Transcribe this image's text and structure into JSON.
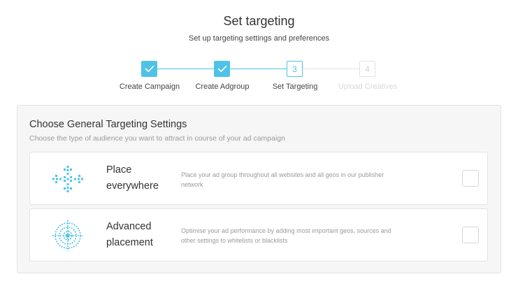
{
  "header": {
    "title": "Set targeting",
    "subtitle": "Set up targeting settings and preferences"
  },
  "stepper": {
    "steps": [
      {
        "number": "1",
        "label": "Create Campaign",
        "state": "completed"
      },
      {
        "number": "2",
        "label": "Create Adgroup",
        "state": "completed"
      },
      {
        "number": "3",
        "label": "Set Targeting",
        "state": "active"
      },
      {
        "number": "4",
        "label": "Upload Creatives",
        "state": "upcoming"
      }
    ]
  },
  "panel": {
    "title": "Choose General Targeting Settings",
    "subtitle": "Choose the type of audience you want to attract in course of your ad campaign",
    "options": [
      {
        "title": "Place everywhere",
        "description": "Place your ad group throughout all websites and all geos in our publisher network",
        "icon": "arrows-outward-icon",
        "checked": false
      },
      {
        "title": "Advanced placement",
        "description": "Optimise your ad performance by adding most important geos, sources and other settings to whitelists or blacklists",
        "icon": "crosshair-target-icon",
        "checked": false
      }
    ]
  },
  "colors": {
    "accent": "#4fc3e6",
    "panel_bg": "#f6f6f6",
    "border": "#e3e3e3",
    "muted_text": "#9a9a9a"
  }
}
